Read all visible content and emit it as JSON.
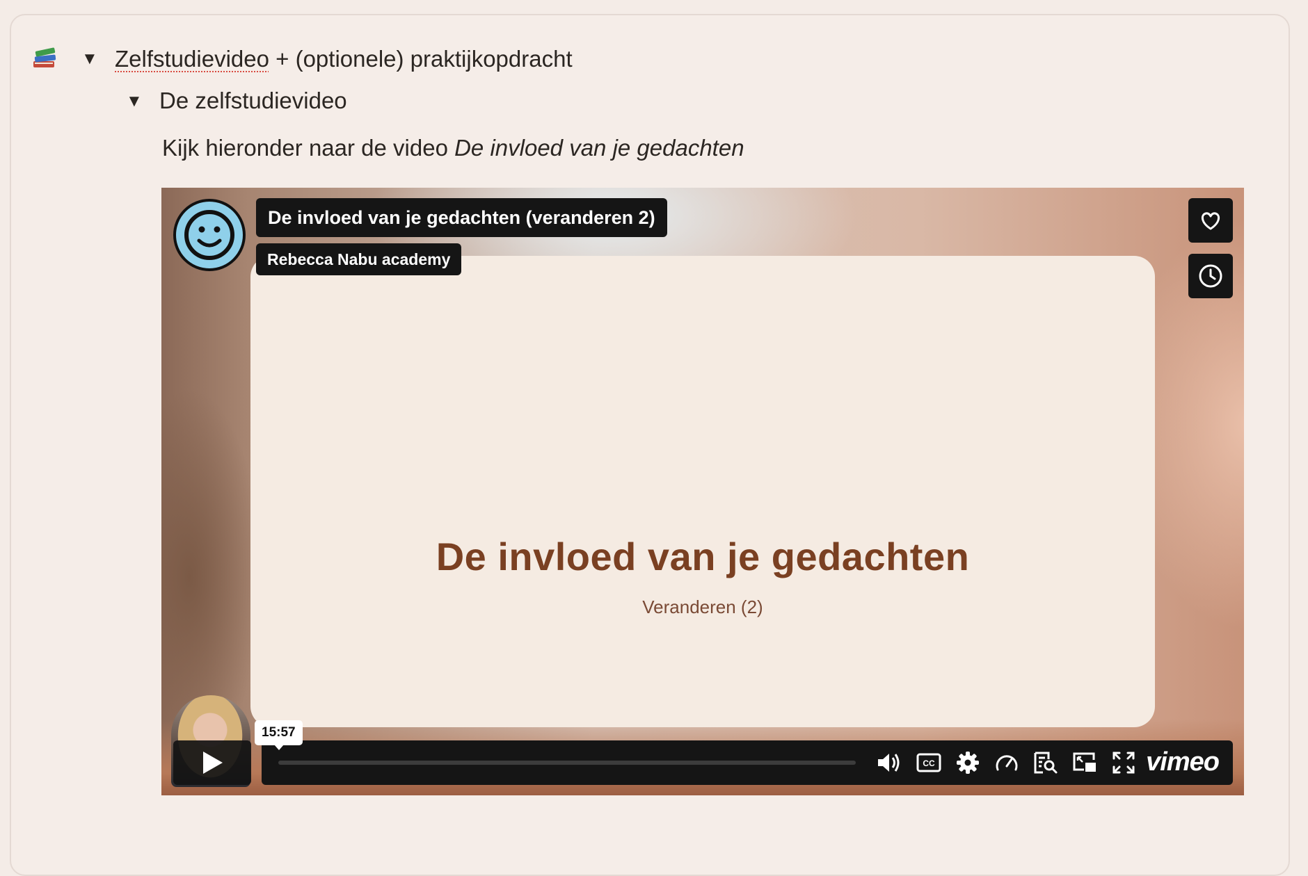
{
  "section": {
    "heading_part1": "Zelfstudievideo",
    "heading_part2": " + (optionele) praktijkopdracht",
    "subheading": "De zelfstudievideo",
    "intro_text": "Kijk hieronder naar de video ",
    "intro_video_title": "De invloed van je gedachten"
  },
  "video": {
    "title": "De invloed van je gedachten (veranderen 2)",
    "owner": "Rebecca Nabu academy",
    "slide_title": "De invloed van je gedachten",
    "slide_subtitle": "Veranderen (2)",
    "duration": "15:57",
    "progress": 0,
    "brand": "vimeo"
  },
  "icons": {
    "books": "books-icon",
    "toggle": "triangle-down-icon",
    "like": "heart-icon",
    "watch_later": "clock-icon",
    "play": "play-icon",
    "volume": "volume-icon",
    "captions": "cc-icon",
    "settings": "gear-icon",
    "speed": "speed-icon",
    "transcript": "transcript-search-icon",
    "pip": "picture-in-picture-icon",
    "fullscreen": "fullscreen-icon"
  },
  "colors": {
    "page_bg": "#f4ece7",
    "slide_bg": "#f5ebe2",
    "slide_title": "#7a4022",
    "player_chrome": "#151515",
    "avatar": "#8fd0ea"
  }
}
